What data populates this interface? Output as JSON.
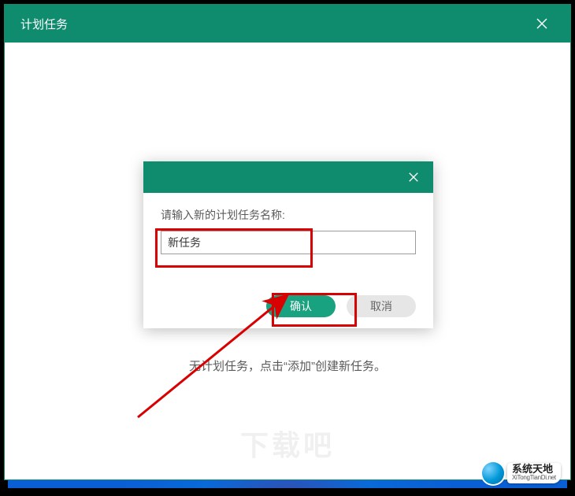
{
  "window": {
    "title": "计划任务"
  },
  "main": {
    "empty_text": "无计划任务，点击“添加”创建新任务。",
    "watermark": "下载吧"
  },
  "dialog": {
    "prompt": "请输入新的计划任务名称:",
    "input_value": "新任务",
    "ok_label": "确认",
    "cancel_label": "取消"
  },
  "logo": {
    "cn": "系统天地",
    "en": "XiTongTianDi.net"
  },
  "icons": {
    "close": "close-icon"
  }
}
